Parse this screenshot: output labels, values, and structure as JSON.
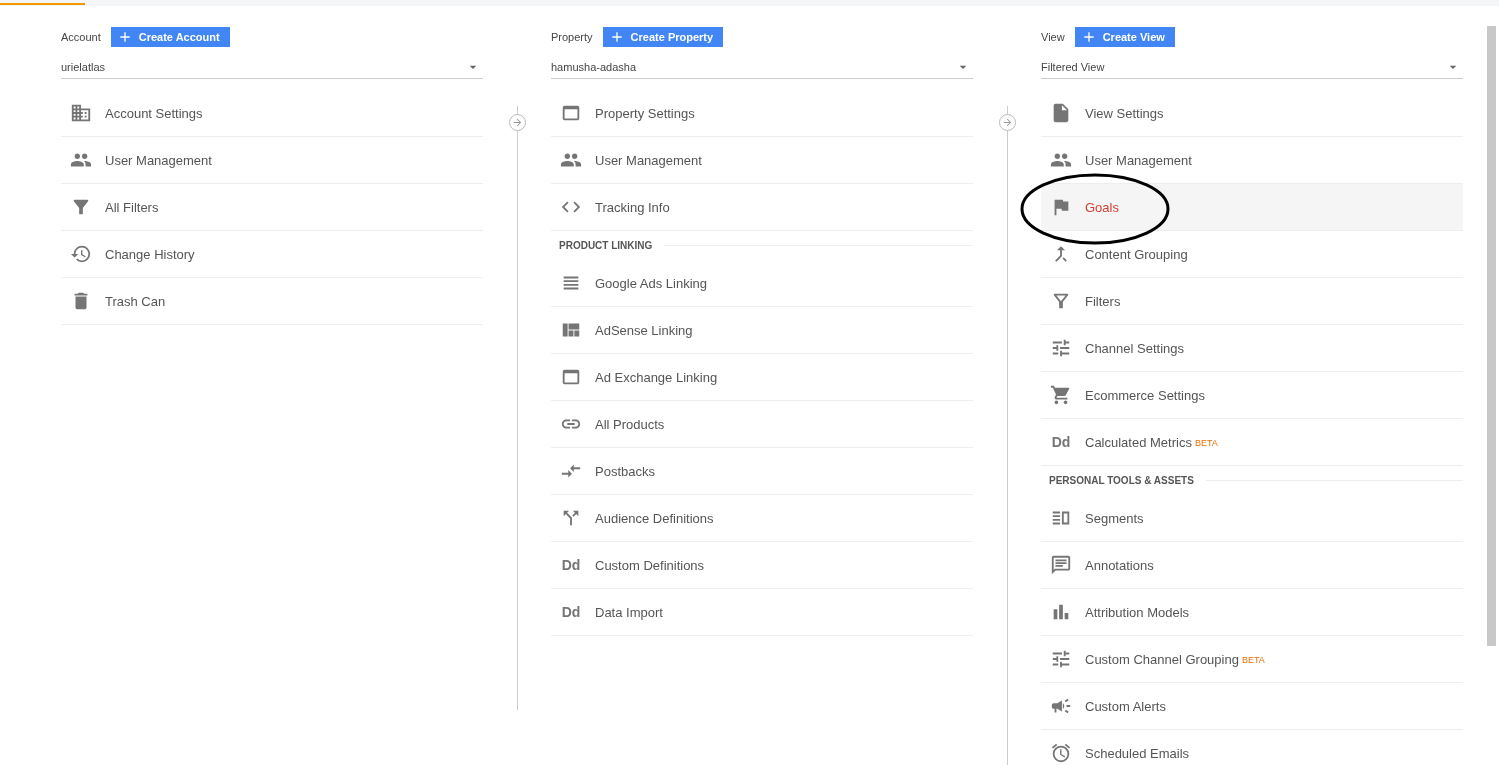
{
  "loading_bar": {
    "level": 0.057
  },
  "columns": [
    {
      "label": "Account",
      "create_button": "Create Account",
      "select_value": "urielatlas",
      "items": [
        {
          "kind": "building",
          "label": "Account Settings",
          "selected": false
        },
        {
          "kind": "people",
          "label": "User Management",
          "selected": false
        },
        {
          "kind": "funnel",
          "label": "All Filters",
          "selected": false
        },
        {
          "kind": "history",
          "label": "Change History",
          "selected": false
        },
        {
          "kind": "trash",
          "label": "Trash Can",
          "selected": false
        }
      ]
    },
    {
      "label": "Property",
      "create_button": "Create Property",
      "select_value": "hamusha-adasha",
      "items": [
        {
          "kind": "window",
          "label": "Property Settings",
          "selected": false
        },
        {
          "kind": "people",
          "label": "User Management",
          "selected": false
        },
        {
          "kind": "code",
          "label": "Tracking Info",
          "selected": false
        },
        {
          "kind": "heading",
          "label": "PRODUCT LINKING"
        },
        {
          "kind": "lines",
          "label": "Google Ads Linking",
          "selected": false
        },
        {
          "kind": "layout",
          "label": "AdSense Linking",
          "selected": false
        },
        {
          "kind": "window",
          "label": "Ad Exchange Linking",
          "selected": false
        },
        {
          "kind": "link",
          "label": "All Products",
          "selected": false
        },
        {
          "kind": "arrows",
          "label": "Postbacks",
          "selected": false
        },
        {
          "kind": "split",
          "label": "Audience Definitions",
          "selected": false
        },
        {
          "kind": "glyph",
          "glyph": "Dd",
          "label": "Custom Definitions",
          "selected": false
        },
        {
          "kind": "glyph",
          "glyph": "Dd",
          "label": "Data Import",
          "selected": false
        }
      ]
    },
    {
      "label": "View",
      "create_button": "Create View",
      "select_value": "Filtered View",
      "items": [
        {
          "kind": "document",
          "label": "View Settings",
          "selected": false,
          "circled": false
        },
        {
          "kind": "people",
          "label": "User Management",
          "selected": false,
          "circled": false
        },
        {
          "kind": "flag",
          "label": "Goals",
          "selected": true,
          "circled": true
        },
        {
          "kind": "merge",
          "label": "Content Grouping",
          "selected": false,
          "circled": false
        },
        {
          "kind": "funnel-outline",
          "label": "Filters",
          "selected": false,
          "circled": false
        },
        {
          "kind": "sliders",
          "label": "Channel Settings",
          "selected": false,
          "circled": false
        },
        {
          "kind": "cart",
          "label": "Ecommerce Settings",
          "selected": false,
          "circled": false
        },
        {
          "kind": "glyph",
          "glyph": "Dd",
          "label": "Calculated Metrics",
          "badge": "BETA",
          "selected": false,
          "circled": false
        },
        {
          "kind": "heading",
          "label": "PERSONAL TOOLS & ASSETS"
        },
        {
          "kind": "columns",
          "label": "Segments",
          "selected": false,
          "circled": false
        },
        {
          "kind": "chat",
          "label": "Annotations",
          "selected": false,
          "circled": false
        },
        {
          "kind": "bars",
          "label": "Attribution Models",
          "selected": false,
          "circled": false
        },
        {
          "kind": "sliders",
          "label": "Custom Channel Grouping",
          "badge": "BETA",
          "selected": false,
          "circled": false
        },
        {
          "kind": "megaphone",
          "label": "Custom Alerts",
          "selected": false,
          "circled": false
        },
        {
          "kind": "clock",
          "label": "Scheduled Emails",
          "selected": false,
          "circled": false
        }
      ]
    }
  ]
}
